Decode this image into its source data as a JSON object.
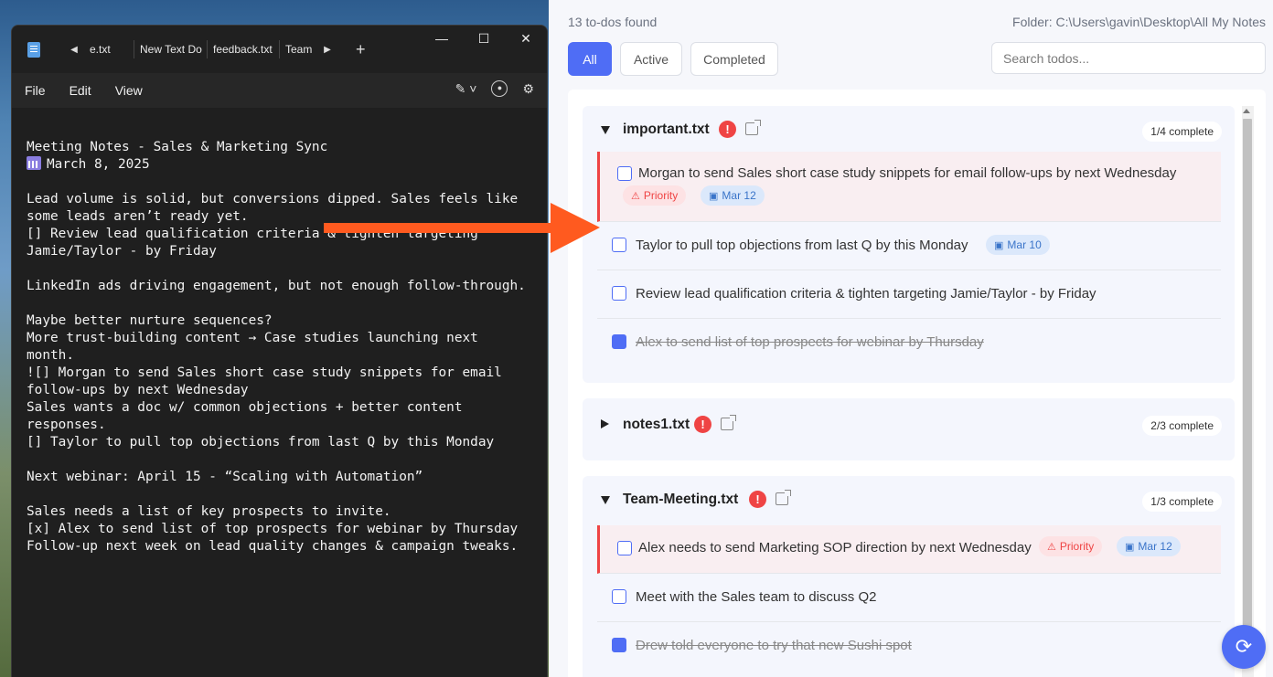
{
  "notepad": {
    "tabs": [
      "e.txt",
      "New Text Do",
      "feedback.txt",
      "Team"
    ],
    "menu": [
      "File",
      "Edit",
      "View"
    ],
    "lines": [
      "Meeting Notes - Sales & Marketing Sync",
      "March 8, 2025",
      "",
      "Lead volume is solid, but conversions dipped. Sales feels like",
      "some leads aren’t ready yet.",
      "[] Review lead qualification criteria & tighten targeting",
      "Jamie/Taylor - by Friday",
      "",
      "LinkedIn ads driving engagement, but not enough follow-through.",
      "",
      "Maybe better nurture sequences?",
      "More trust-building content → Case studies launching next",
      "month.",
      "![] Morgan to send Sales short case study snippets for email",
      "follow-ups by next Wednesday",
      "Sales wants a doc w/ common objections + better content",
      "responses.",
      "[] Taylor to pull top objections from last Q by this Monday",
      "",
      "Next webinar: April 15 - “Scaling with Automation”",
      "",
      "Sales needs a list of key prospects to invite.",
      "[x] Alex to send list of top prospects for webinar by Thursday",
      "Follow-up next week on lead quality changes & campaign tweaks."
    ],
    "calendar_icon": "calendar-icon"
  },
  "app": {
    "found": "13 to-dos found",
    "folder": "Folder: C:\\Users\\gavin\\Desktop\\All My Notes",
    "filters": {
      "all": "All",
      "active": "Active",
      "completed": "Completed"
    },
    "search_placeholder": "Search todos...",
    "accent": "#4f6df5",
    "priority_color": "#ef4444",
    "groups": [
      {
        "name": "important.txt",
        "count": "1/4 complete",
        "todos": [
          {
            "text": "Morgan to send Sales short case study snippets for email follow-ups by next Wednesday",
            "priority": "Priority",
            "date": "Mar 12"
          },
          {
            "text": "Taylor to pull top objections from last Q by this Monday",
            "date": "Mar 10"
          },
          {
            "text": "Review lead qualification criteria & tighten targeting Jamie/Taylor - by Friday"
          },
          {
            "text": "Alex to send list of top prospects for webinar by Thursday",
            "done": true
          }
        ]
      },
      {
        "name": "notes1.txt",
        "count": "2/3 complete"
      },
      {
        "name": "Team-Meeting.txt",
        "count": "1/3 complete",
        "todos": [
          {
            "text": "Alex needs to send Marketing SOP direction by next Wednesday",
            "priority": "Priority",
            "date": "Mar 12"
          },
          {
            "text": "Meet with the Sales team to discuss Q2"
          },
          {
            "text": "Drew told everyone to try that new Sushi spot",
            "done": true
          }
        ]
      }
    ]
  }
}
